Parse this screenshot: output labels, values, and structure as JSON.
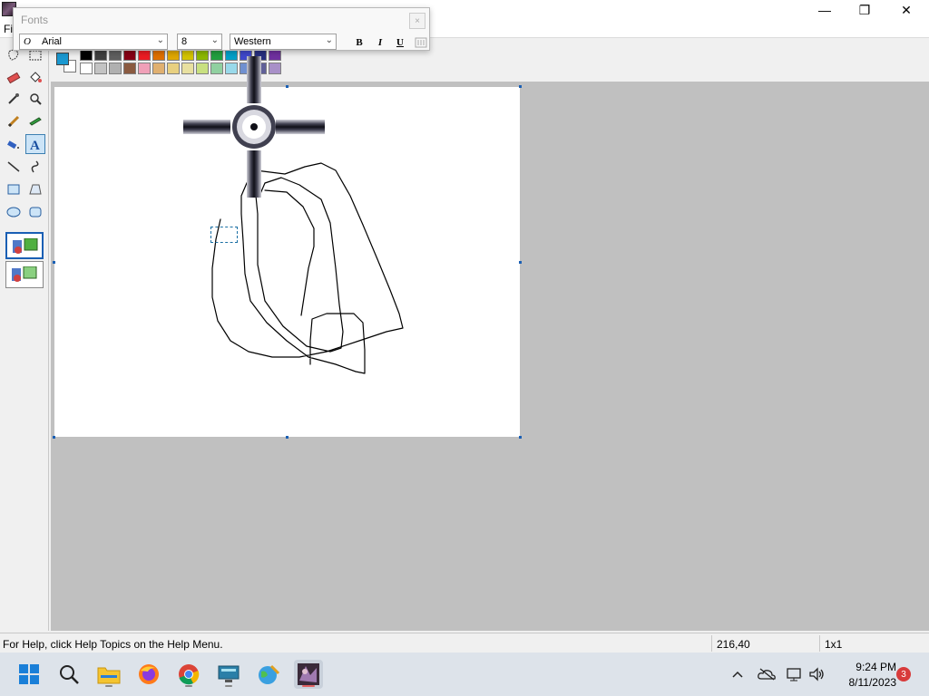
{
  "titlebar": {
    "title": "",
    "minimize_glyph": "—",
    "maximize_glyph": "❐",
    "close_glyph": "✕"
  },
  "menubar": {
    "items": [
      "Fi"
    ]
  },
  "fonts_dialog": {
    "title": "Fonts",
    "close_glyph": "×",
    "font_name": "Arial",
    "font_glyph": "O",
    "font_size": "8",
    "script": "Western",
    "bold_label": "B",
    "italic_label": "I",
    "underline_label": "U"
  },
  "palette": {
    "foreground": "#1a98d0",
    "background": "#ffffff",
    "row1": [
      "#000000",
      "#404040",
      "#606060",
      "#880015",
      "#ed1c24",
      "#e07000",
      "#e0a800",
      "#d4c400",
      "#8cb800",
      "#22a040",
      "#00a0c8",
      "#3f48cc",
      "#283080",
      "#7030a0"
    ],
    "row2": [
      "#ffffff",
      "#c3c3c3",
      "#b0b0b0",
      "#8a5a40",
      "#f0a0b8",
      "#e0b070",
      "#e8d080",
      "#e8e0a0",
      "#c8e080",
      "#90d0a0",
      "#99d9ea",
      "#7090d0",
      "#606098",
      "#a890c8"
    ]
  },
  "status": {
    "help": "For Help, click Help Topics on the Help Menu.",
    "coords": "216,40",
    "size": "1x1"
  },
  "taskbar": {
    "time": "9:24 PM",
    "date": "8/11/2023",
    "notifications": "3"
  },
  "icons": {
    "tray_up": "^",
    "volume": "🔊",
    "search": "⌕"
  }
}
